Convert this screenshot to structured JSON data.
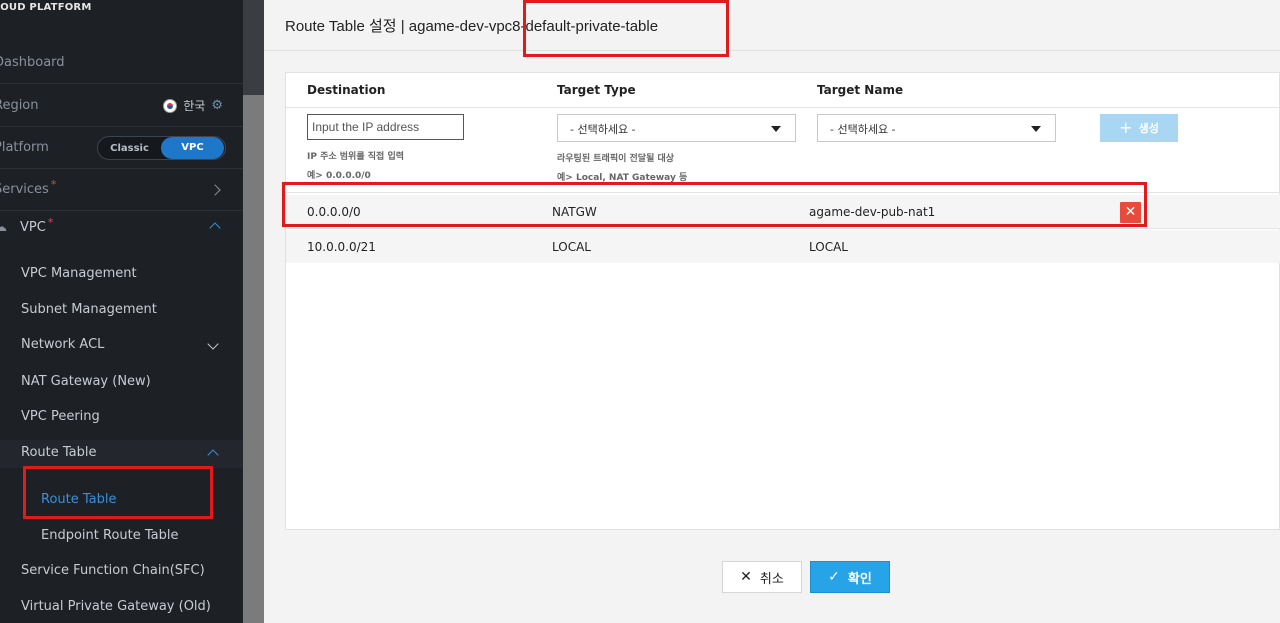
{
  "sidebar": {
    "logo": "LOUD PLATFORM",
    "dashboard": "Dashboard",
    "region_label": "Region",
    "region_value": "한국",
    "platform_label": "Platform",
    "platform_options": [
      "Classic",
      "VPC"
    ],
    "platform_selected": "VPC",
    "services_label": "Services",
    "vpc_label": "VPC",
    "items": [
      {
        "label": "VPC Management"
      },
      {
        "label": "Subnet Management"
      },
      {
        "label": "Network ACL"
      },
      {
        "label": "NAT Gateway (New)"
      },
      {
        "label": "VPC Peering"
      },
      {
        "label": "Route Table"
      },
      {
        "label": "Service Function Chain(SFC)"
      },
      {
        "label": "Virtual Private Gateway (Old)"
      }
    ],
    "route_table_children": [
      {
        "label": "Route Table"
      },
      {
        "label": "Endpoint Route Table"
      }
    ]
  },
  "modal": {
    "title": "Route Table 설정 | agame-dev-vpc8-default-private-table",
    "columns": [
      "Destination",
      "Target Type",
      "Target Name"
    ],
    "destination_placeholder": "Input the IP address",
    "destination_help_1": "IP 주소 범위를 직접 입력",
    "destination_help_2": "예> 0.0.0.0/0",
    "target_type_select": "- 선택하세요 -",
    "target_type_help_1": "라우팅된 트래픽이 전달될 대상",
    "target_type_help_2": "예> Local, NAT Gateway 등",
    "target_name_select": "- 선택하세요 -",
    "create_label": "생성",
    "rows": [
      {
        "destination": "0.0.0.0/0",
        "target_type": "NATGW",
        "target_name": "agame-dev-pub-nat1"
      },
      {
        "destination": "10.0.0.0/21",
        "target_type": "LOCAL",
        "target_name": "LOCAL"
      }
    ],
    "cancel_label": "취소",
    "ok_label": "확인"
  },
  "colors": {
    "highlight": "#e11b1b",
    "primary": "#27a3e8",
    "sidebar_bg": "#1d2126",
    "active_link": "#3a8fdc",
    "delete": "#e84b3c"
  }
}
